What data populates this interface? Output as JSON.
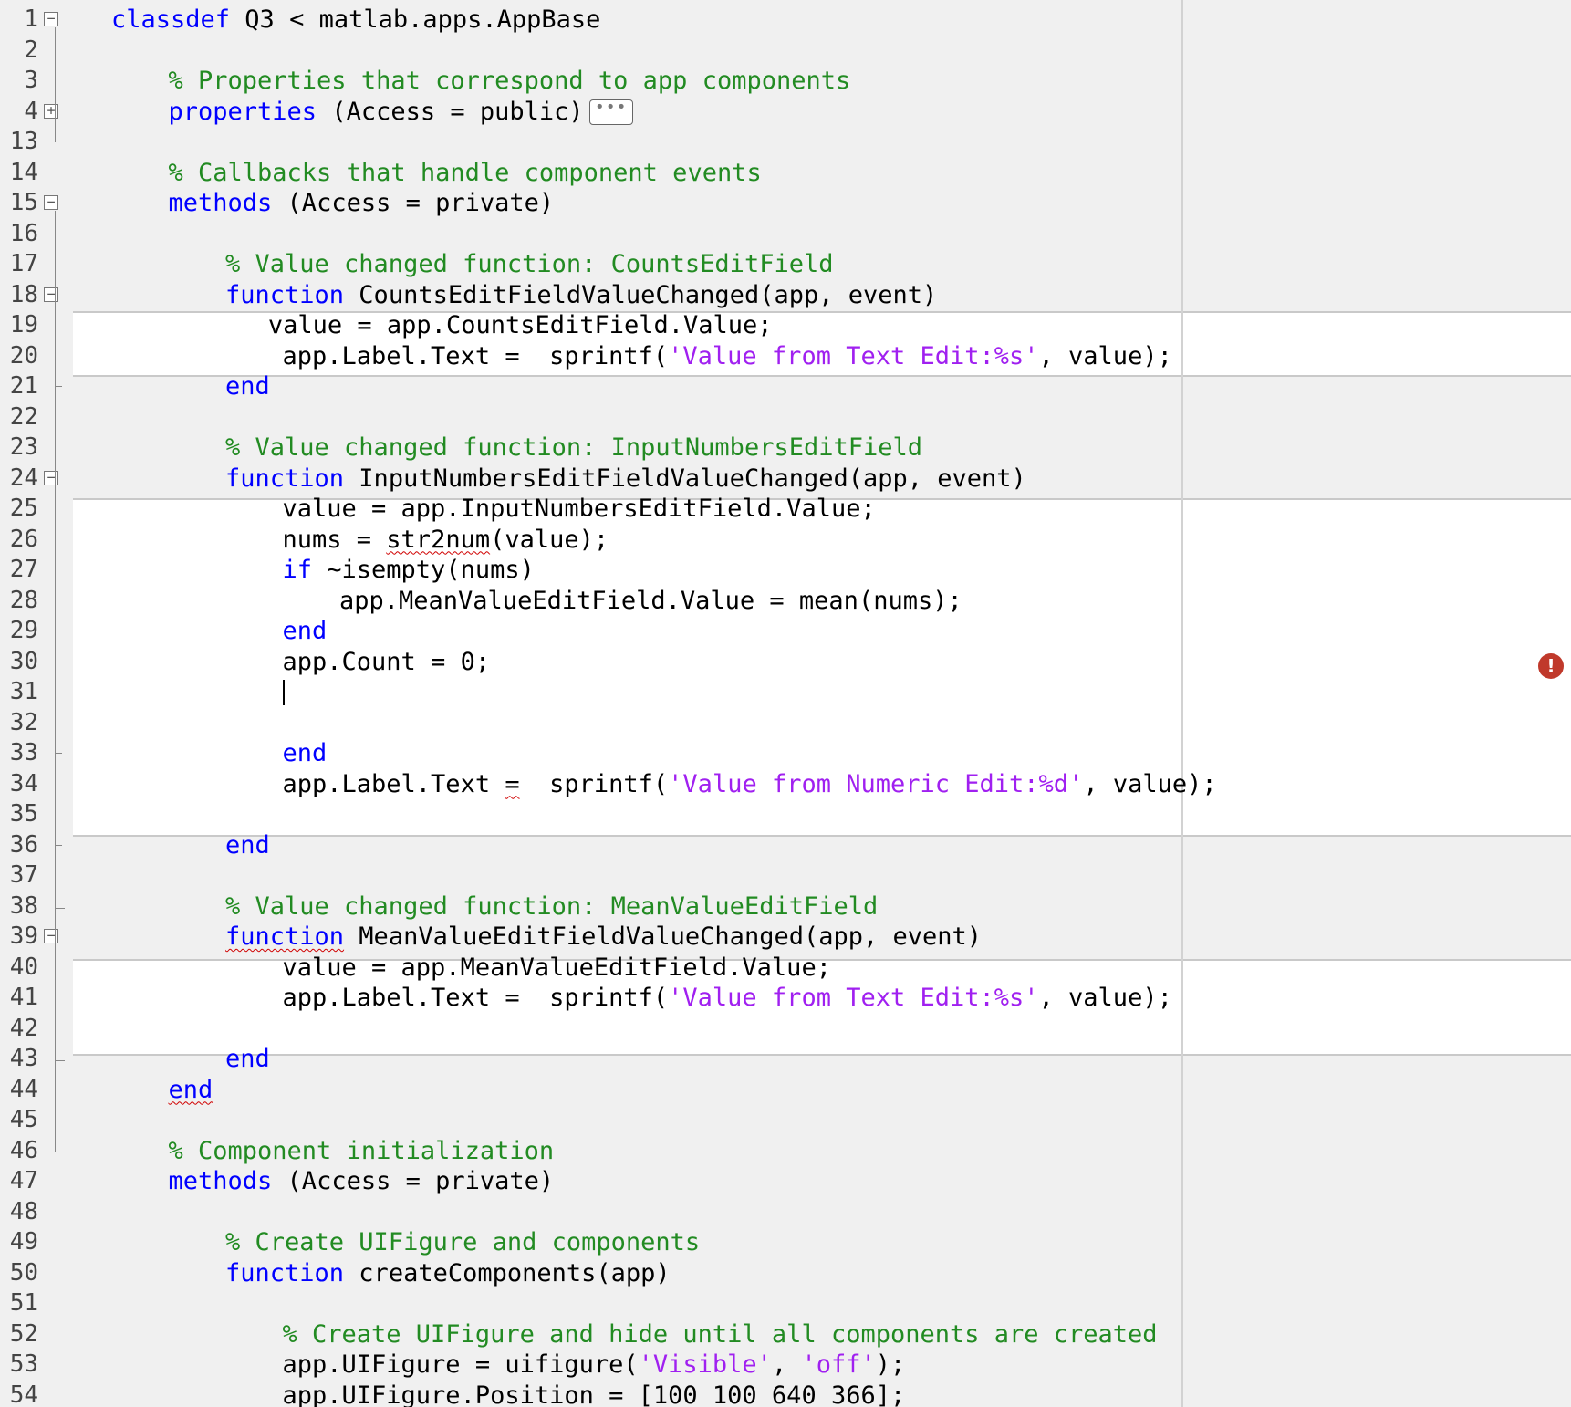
{
  "editor": {
    "lines": [
      {
        "n": "1",
        "fold": "minus",
        "indent": 0,
        "tokens": [
          {
            "t": "kw",
            "v": "classdef"
          },
          {
            "t": "plain",
            "v": " Q3 < matlab.apps.AppBase"
          }
        ]
      },
      {
        "n": "2",
        "indent": 0,
        "tokens": []
      },
      {
        "n": "3",
        "indent": 1,
        "tokens": [
          {
            "t": "cm",
            "v": "% Properties that correspond to app components"
          }
        ]
      },
      {
        "n": "4",
        "fold": "plus",
        "indent": 1,
        "tokens": [
          {
            "t": "kw",
            "v": "properties"
          },
          {
            "t": "plain",
            "v": " (Access = public)"
          }
        ],
        "ellipsis": "•••"
      },
      {
        "n": "13",
        "indent": 0,
        "tokens": []
      },
      {
        "n": "14",
        "indent": 1,
        "tokens": [
          {
            "t": "cm",
            "v": "% Callbacks that handle component events"
          }
        ]
      },
      {
        "n": "15",
        "fold": "minus",
        "indent": 1,
        "tokens": [
          {
            "t": "kw",
            "v": "methods"
          },
          {
            "t": "plain",
            "v": " (Access = private)"
          }
        ]
      },
      {
        "n": "16",
        "indent": 0,
        "tokens": []
      },
      {
        "n": "17",
        "indent": 2,
        "tokens": [
          {
            "t": "cm",
            "v": "% Value changed function: CountsEditField"
          }
        ]
      },
      {
        "n": "18",
        "fold": "minus",
        "indent": 2,
        "tokens": [
          {
            "t": "kw",
            "v": "function"
          },
          {
            "t": "plain",
            "v": " CountsEditFieldValueChanged(app, event)"
          }
        ]
      },
      {
        "n": "19",
        "indent": 2.75,
        "tokens": [
          {
            "t": "plain",
            "v": "value = app.CountsEditField.Value;"
          }
        ]
      },
      {
        "n": "20",
        "indent": 3,
        "tokens": [
          {
            "t": "plain",
            "v": "app.Label.Text =  sprintf("
          },
          {
            "t": "str",
            "v": "'Value from Text Edit:%s'"
          },
          {
            "t": "plain",
            "v": ", value);"
          }
        ]
      },
      {
        "n": "21",
        "fold": "end",
        "indent": 2,
        "tokens": [
          {
            "t": "kw",
            "v": "end"
          }
        ]
      },
      {
        "n": "22",
        "indent": 0,
        "tokens": []
      },
      {
        "n": "23",
        "indent": 2,
        "tokens": [
          {
            "t": "cm",
            "v": "% Value changed function: InputNumbersEditField"
          }
        ]
      },
      {
        "n": "24",
        "fold": "minus",
        "indent": 2,
        "tokens": [
          {
            "t": "kw",
            "v": "function"
          },
          {
            "t": "plain",
            "v": " InputNumbersEditFieldValueChanged(app, event)"
          }
        ]
      },
      {
        "n": "25",
        "indent": 3,
        "tokens": [
          {
            "t": "plain",
            "v": "value = app.InputNumbersEditField.Value;"
          }
        ]
      },
      {
        "n": "26",
        "indent": 3,
        "tokens": [
          {
            "t": "plain",
            "v": "nums = "
          },
          {
            "t": "plain",
            "v": "str2num",
            "sq": true
          },
          {
            "t": "plain",
            "v": "(value);"
          }
        ]
      },
      {
        "n": "27",
        "indent": 3,
        "tokens": [
          {
            "t": "kw",
            "v": "if"
          },
          {
            "t": "plain",
            "v": " ~isempty(nums)"
          }
        ]
      },
      {
        "n": "28",
        "indent": 4,
        "tokens": [
          {
            "t": "plain",
            "v": "app.MeanValueEditField.Value = mean(nums);"
          }
        ]
      },
      {
        "n": "29",
        "indent": 3,
        "tokens": [
          {
            "t": "kw",
            "v": "end"
          }
        ]
      },
      {
        "n": "30",
        "indent": 3,
        "tokens": [
          {
            "t": "plain",
            "v": "app.Count = 0;"
          }
        ]
      },
      {
        "n": "31",
        "indent": 3,
        "tokens": [],
        "caret": true
      },
      {
        "n": "32",
        "indent": 0,
        "tokens": []
      },
      {
        "n": "33",
        "fold": "end",
        "indent": 3,
        "tokens": [
          {
            "t": "kw",
            "v": "end"
          }
        ]
      },
      {
        "n": "34",
        "indent": 3,
        "tokens": [
          {
            "t": "plain",
            "v": "app.Label.Text "
          },
          {
            "t": "plain",
            "v": "=",
            "sq": true
          },
          {
            "t": "plain",
            "v": "  sprintf("
          },
          {
            "t": "str",
            "v": "'Value from Numeric Edit:%d'"
          },
          {
            "t": "plain",
            "v": ", value);"
          }
        ]
      },
      {
        "n": "35",
        "indent": 0,
        "tokens": []
      },
      {
        "n": "36",
        "fold": "end",
        "indent": 2,
        "tokens": [
          {
            "t": "kw",
            "v": "end"
          }
        ]
      },
      {
        "n": "37",
        "indent": 0,
        "tokens": []
      },
      {
        "n": "38",
        "fold": "endclose",
        "indent": 2,
        "tokens": [
          {
            "t": "cm",
            "v": "% Value changed function: MeanValueEditField"
          }
        ]
      },
      {
        "n": "39",
        "fold": "minus",
        "indent": 2,
        "tokens": [
          {
            "t": "kw",
            "v": "function",
            "sq": true
          },
          {
            "t": "plain",
            "v": " MeanValueEditFieldValueChanged(app, event)"
          }
        ]
      },
      {
        "n": "40",
        "indent": 3,
        "tokens": [
          {
            "t": "plain",
            "v": "value = app.MeanValueEditField.Value;"
          }
        ]
      },
      {
        "n": "41",
        "indent": 3,
        "tokens": [
          {
            "t": "plain",
            "v": "app.Label.Text =  sprintf("
          },
          {
            "t": "str",
            "v": "'Value from Text Edit:%s'"
          },
          {
            "t": "plain",
            "v": ", value);"
          }
        ]
      },
      {
        "n": "42",
        "indent": 0,
        "tokens": []
      },
      {
        "n": "43",
        "fold": "endclose",
        "indent": 2,
        "tokens": [
          {
            "t": "kw",
            "v": "end"
          }
        ]
      },
      {
        "n": "44",
        "indent": 1,
        "tokens": [
          {
            "t": "kw",
            "v": "end",
            "sq": true
          }
        ]
      },
      {
        "n": "45",
        "indent": 0,
        "tokens": []
      },
      {
        "n": "46",
        "indent": 1,
        "tokens": [
          {
            "t": "cm",
            "v": "% Component initialization"
          }
        ]
      },
      {
        "n": "47",
        "indent": 1,
        "tokens": [
          {
            "t": "kw",
            "v": "methods"
          },
          {
            "t": "plain",
            "v": " (Access = private)"
          }
        ]
      },
      {
        "n": "48",
        "indent": 0,
        "tokens": []
      },
      {
        "n": "49",
        "indent": 2,
        "tokens": [
          {
            "t": "cm",
            "v": "% Create UIFigure and components"
          }
        ]
      },
      {
        "n": "50",
        "indent": 2,
        "tokens": [
          {
            "t": "kw",
            "v": "function"
          },
          {
            "t": "plain",
            "v": " createComponents(app)"
          }
        ]
      },
      {
        "n": "51",
        "indent": 0,
        "tokens": []
      },
      {
        "n": "52",
        "indent": 3,
        "tokens": [
          {
            "t": "cm",
            "v": "% Create UIFigure and hide until all components are created"
          }
        ]
      },
      {
        "n": "53",
        "indent": 3,
        "tokens": [
          {
            "t": "plain",
            "v": "app.UIFigure = uifigure("
          },
          {
            "t": "str",
            "v": "'Visible'"
          },
          {
            "t": "plain",
            "v": ", "
          },
          {
            "t": "str",
            "v": "'off'"
          },
          {
            "t": "plain",
            "v": ");"
          }
        ]
      },
      {
        "n": "54",
        "indent": 3,
        "tokens": [
          {
            "t": "plain",
            "v": "app.UIFigure.Position = [100 100 640 366];"
          }
        ]
      }
    ],
    "error_marker": "!"
  }
}
